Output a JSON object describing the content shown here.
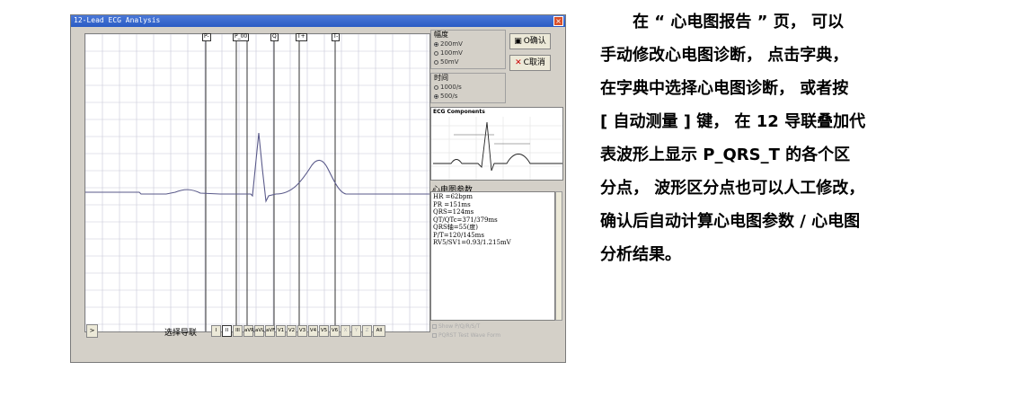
{
  "window": {
    "title": "12-Lead ECG Analysis",
    "close_glyph": "×"
  },
  "markers": [
    "P-",
    "P_00",
    "Q",
    "T+",
    "T-"
  ],
  "amplitude": {
    "label": "幅度",
    "options": [
      "200mV",
      "100mV",
      "50mV"
    ],
    "selected": "200mV"
  },
  "time": {
    "label": "时间",
    "options": [
      "1000/s",
      "500/s"
    ],
    "selected": "500/s"
  },
  "buttons": {
    "ok_label": "O确认",
    "cancel_label": "C取消"
  },
  "thumbnail": {
    "caption": "ECG Components"
  },
  "params": {
    "title": "心电图参数",
    "lines": [
      "HR =62bpm",
      "PR =151ms",
      "QRS=124ms",
      "QT/QTc=371/379ms",
      "QRS轴=55(度)",
      "P/T=120/145ms",
      "RV5/SV1=0.93/1.215mV"
    ]
  },
  "checkboxes": [
    "Show P/Q/R/S/T",
    "PQRST Test Wave Form"
  ],
  "leads": {
    "label": "选择导联",
    "items": [
      "I",
      "II",
      "III",
      "aVR",
      "aVL",
      "aVF",
      "V1",
      "V2",
      "V3",
      "V4",
      "V5",
      "V6",
      "X",
      "Y",
      "Z",
      "All"
    ],
    "selected": "II",
    "disabled": [
      "X",
      "Y",
      "Z"
    ]
  },
  "expand_label": ">",
  "description": [
    "　　在 “ 心电图报告 ” 页， 可以",
    "手动修改心电图诊断， 点击字典，",
    "在字典中选择心电图诊断， 或者按",
    "[ 自动测量 ] 键， 在 12 导联叠加代",
    "表波形上显示 P_QRS_T 的各个区",
    "分点， 波形区分点也可以人工修改，",
    "确认后自动计算心电图参数 / 心电图",
    "分析结果。"
  ]
}
